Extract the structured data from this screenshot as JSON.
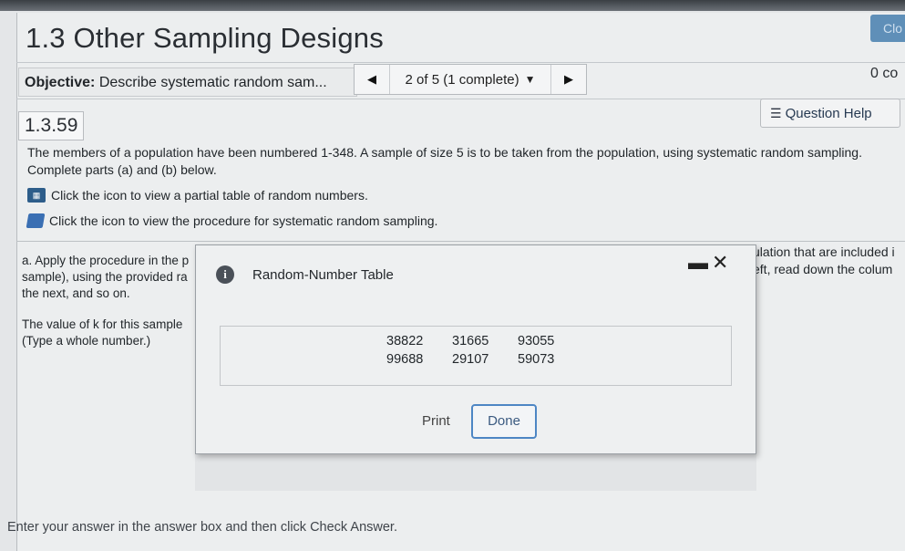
{
  "window": {
    "close_label": "Clo"
  },
  "header": {
    "title": "1.3 Other Sampling Designs",
    "objective_label": "Objective:",
    "objective_text": "Describe systematic random sam...",
    "nav_progress": "2 of 5 (1 complete)",
    "score": "0 co"
  },
  "question": {
    "number": "1.3.59",
    "help_label": "Question Help",
    "text": "The members of a population have been numbered 1-348. A sample of size 5 is to be taken from the population, using systematic random sampling. Complete parts (a) and (b) below.",
    "icon_link_1": "Click the icon to view a partial table of random numbers.",
    "icon_link_2": "Click the icon to view the procedure for systematic random sampling.",
    "part_a_line1": "a. Apply the procedure in the p",
    "part_a_line2": "sample), using the provided ra",
    "part_a_line3": "the next, and so on.",
    "part_a_right1": "ulation that are included i",
    "part_a_right2": "eft, read down the colum",
    "k_prompt": "The value of k for this sample",
    "k_hint": "(Type a whole number.)",
    "footer": "Enter your answer in the answer box and then click Check Answer."
  },
  "dialog": {
    "title": "Random-Number Table",
    "rows": [
      [
        "38822",
        "31665",
        "93055"
      ],
      [
        "99688",
        "29107",
        "59073"
      ]
    ],
    "print_label": "Print",
    "done_label": "Done"
  }
}
